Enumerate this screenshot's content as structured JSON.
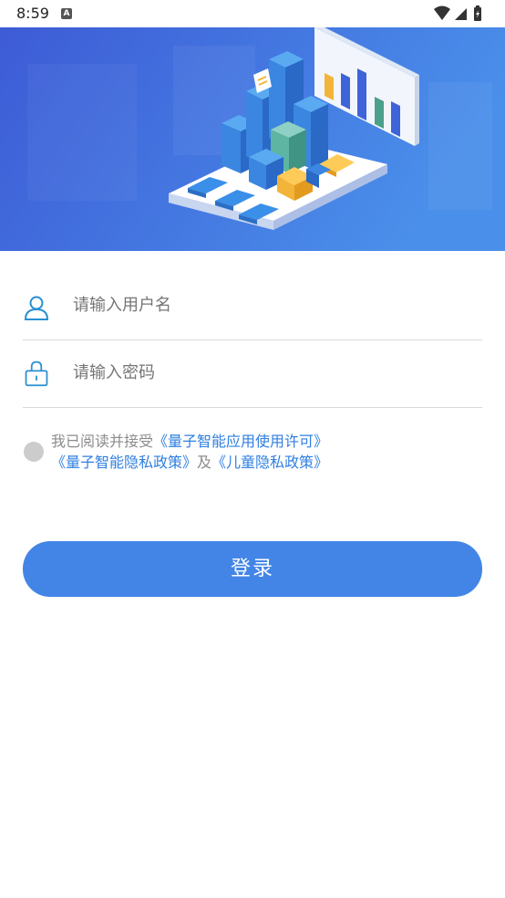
{
  "status_bar": {
    "time": "8:59",
    "notification_icon": "text-notification-icon",
    "icons": [
      "wifi-icon",
      "signal-icon",
      "battery-icon"
    ]
  },
  "banner": {
    "illustration": "data-analytics-isometric-illustration",
    "background_color": "#3f63d8"
  },
  "login_form": {
    "username": {
      "icon": "user-icon",
      "placeholder": "请输入用户名"
    },
    "password": {
      "icon": "lock-icon",
      "placeholder": "请输入密码"
    },
    "agreement": {
      "prefix": "我已阅读并接受",
      "license_link": "《量子智能应用使用许可》",
      "privacy_link": "《量子智能隐私政策》",
      "connector": "及",
      "child_privacy_link": "《儿童隐私政策》",
      "checked": false
    },
    "submit_label": "登录"
  },
  "colors": {
    "accent": "#4385e6",
    "link": "#2f7fe0",
    "icon": "#2a8fd0",
    "divider": "#d9d9d9"
  }
}
